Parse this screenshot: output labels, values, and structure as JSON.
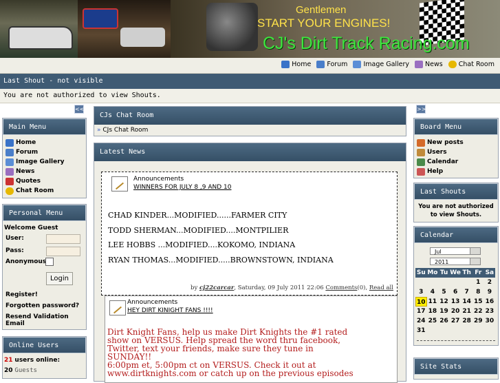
{
  "banner": {
    "line1": "Gentlemen",
    "line2": "START YOUR ENGINES!",
    "site_name": "CJ's Dirt Track Racing.com"
  },
  "topnav": [
    {
      "label": "Home",
      "icon": "home-icon",
      "color": "#3a73c8"
    },
    {
      "label": "Forum",
      "icon": "forum-icon",
      "color": "#4a7ec9"
    },
    {
      "label": "Image Gallery",
      "icon": "gallery-icon",
      "color": "#5b8ed6"
    },
    {
      "label": "News",
      "icon": "news-icon",
      "color": "#9a6fc0"
    },
    {
      "label": "Chat Room",
      "icon": "chat-icon",
      "color": "#e6b800"
    }
  ],
  "shout": {
    "title": "Last Shout - not visible",
    "message": "You are not authorized to view Shouts."
  },
  "left": {
    "collapse": "<<",
    "main_menu": {
      "title": "Main Menu",
      "items": [
        "Home",
        "Forum",
        "Image Gallery",
        "News",
        "Quotes",
        "Chat Room"
      ]
    },
    "personal_menu": {
      "title": "Personal Menu",
      "welcome": "Welcome Guest",
      "user_label": "User:",
      "pass_label": "Pass:",
      "anon_label": "Anonymous:",
      "login_button": "Login",
      "links": [
        "Register!",
        "Forgotten password?",
        "Resend Validation Email"
      ]
    },
    "online": {
      "title": "Online Users",
      "count": "21",
      "count_label": "users online:",
      "guests_count": "20",
      "guests_label": "Guests"
    }
  },
  "middle": {
    "chat": {
      "title": "CJs Chat Room",
      "link": "CJs Chat Room"
    },
    "news": {
      "title": "Latest News",
      "articles": [
        {
          "category": "Announcements",
          "title": "WINNERS FOR JULY 8 ,9 AND 10",
          "lines": [
            "CHAD KINDER...MODIFIED......FARMER CITY",
            "TODD SHERMAN...MODIFIED....MONTPILIER",
            "LEE HOBBS ...MODIFIED....KOKOMO, INDIANA",
            "RYAN THOMAS...MODIFIED.....BROWNSTOWN, INDIANA"
          ],
          "byline_prefix": "by",
          "author": "cj22carcar",
          "date": ", Saturday, 09 July 2011 22:06",
          "comments": "Comments",
          "comments_count": "(0)",
          "read_all": "Read all"
        },
        {
          "category": "Announcements",
          "title": "HEY DIRT KINIGHT FANS !!!!",
          "lines": [
            "Dirt Knight Fans, help us make Dirt Knights the #1 rated",
            "show on VERSUS. Help spread the word thru facebook,",
            "Twitter, text your friends, make sure they tune in",
            "SUNDAY!!",
            "6:00pm et, 5:00pm ct on VERSUS. Check it out at",
            "www.dirtknights.com or catch up on the previous episodes"
          ]
        }
      ]
    }
  },
  "right": {
    "collapse": ">>",
    "board_menu": {
      "title": "Board Menu",
      "items": [
        "New posts",
        "Users",
        "Calendar",
        "Help"
      ]
    },
    "last_shouts": {
      "title": "Last Shouts",
      "message": "You are not authorized to view Shouts."
    },
    "calendar": {
      "title": "Calendar",
      "month": "Jul",
      "year": "2011",
      "weekdays": [
        "Su",
        "Mo",
        "Tu",
        "We",
        "Th",
        "Fr",
        "Sa"
      ],
      "weeks": [
        [
          "",
          "",
          "",
          "",
          "",
          "1",
          "2"
        ],
        [
          "3",
          "4",
          "5",
          "6",
          "7",
          "8",
          "9"
        ],
        [
          "10",
          "11",
          "12",
          "13",
          "14",
          "15",
          "16"
        ],
        [
          "17",
          "18",
          "19",
          "20",
          "21",
          "22",
          "23"
        ],
        [
          "24",
          "25",
          "26",
          "27",
          "28",
          "29",
          "30"
        ],
        [
          "31",
          "",
          "",
          "",
          "",
          "",
          ""
        ]
      ],
      "today": "10"
    },
    "site_stats": {
      "title": "Site Stats"
    }
  }
}
